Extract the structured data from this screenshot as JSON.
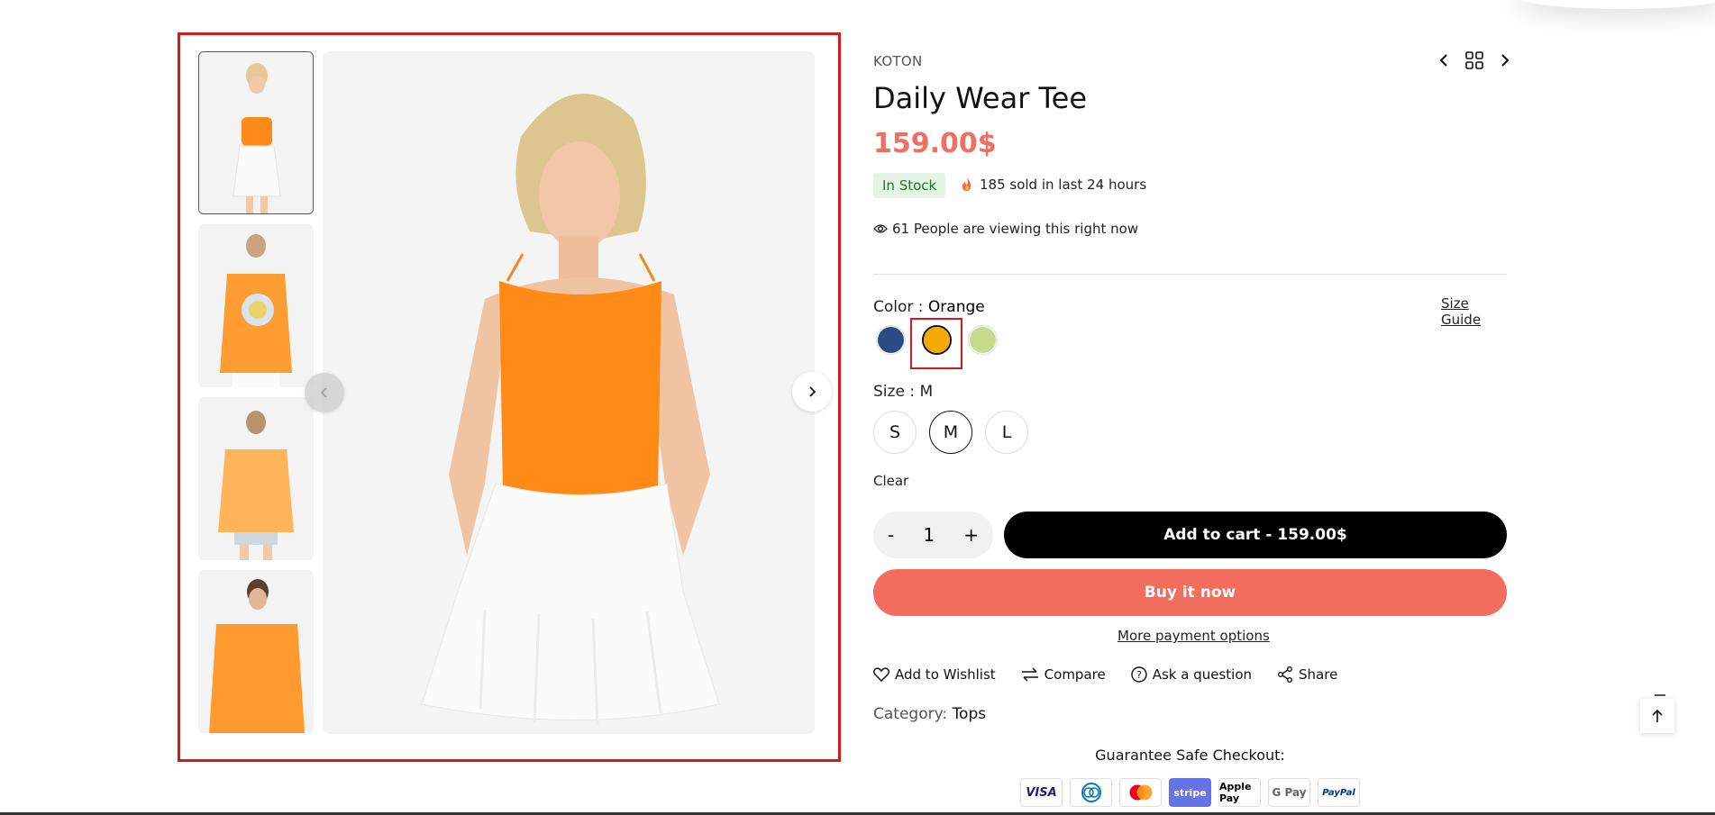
{
  "product": {
    "brand": "KOTON",
    "title": "Daily Wear Tee",
    "price": "159.00$",
    "stock_status": "In Stock",
    "sold_text": "185 sold in last 24 hours",
    "viewing_text": "61 People are viewing this right now"
  },
  "color": {
    "label": "Color :",
    "selected": "Orange",
    "size_guide": "Size Guide",
    "swatches": [
      {
        "name": "Navy",
        "hex": "#2b4a86"
      },
      {
        "name": "Orange",
        "hex": "#f4aa00"
      },
      {
        "name": "Light Green",
        "hex": "#c7d98a"
      }
    ]
  },
  "size": {
    "label": "Size :",
    "selected": "M",
    "options": [
      "S",
      "M",
      "L"
    ],
    "clear": "Clear"
  },
  "cart": {
    "minus": "-",
    "quantity": "1",
    "plus": "+",
    "add_to_cart": "Add to cart - 159.00$",
    "buy_now": "Buy it now",
    "more_payment": "More payment options"
  },
  "actions": {
    "wishlist": "Add to Wishlist",
    "compare": "Compare",
    "ask": "Ask a question",
    "share": "Share"
  },
  "category": {
    "label": "Category:",
    "value": "Tops"
  },
  "checkout": {
    "guarantee": "Guarantee Safe Checkout:",
    "methods": [
      "VISA",
      "Diners",
      "Mastercard",
      "stripe",
      "Apple Pay",
      "G Pay",
      "PayPal"
    ]
  },
  "colors": {
    "price": "#ef6f61",
    "buy_now": "#f26d5e",
    "highlight": "#d21a1a",
    "stock_bg": "#e5f5e5",
    "stock_text": "#1d7a24"
  }
}
